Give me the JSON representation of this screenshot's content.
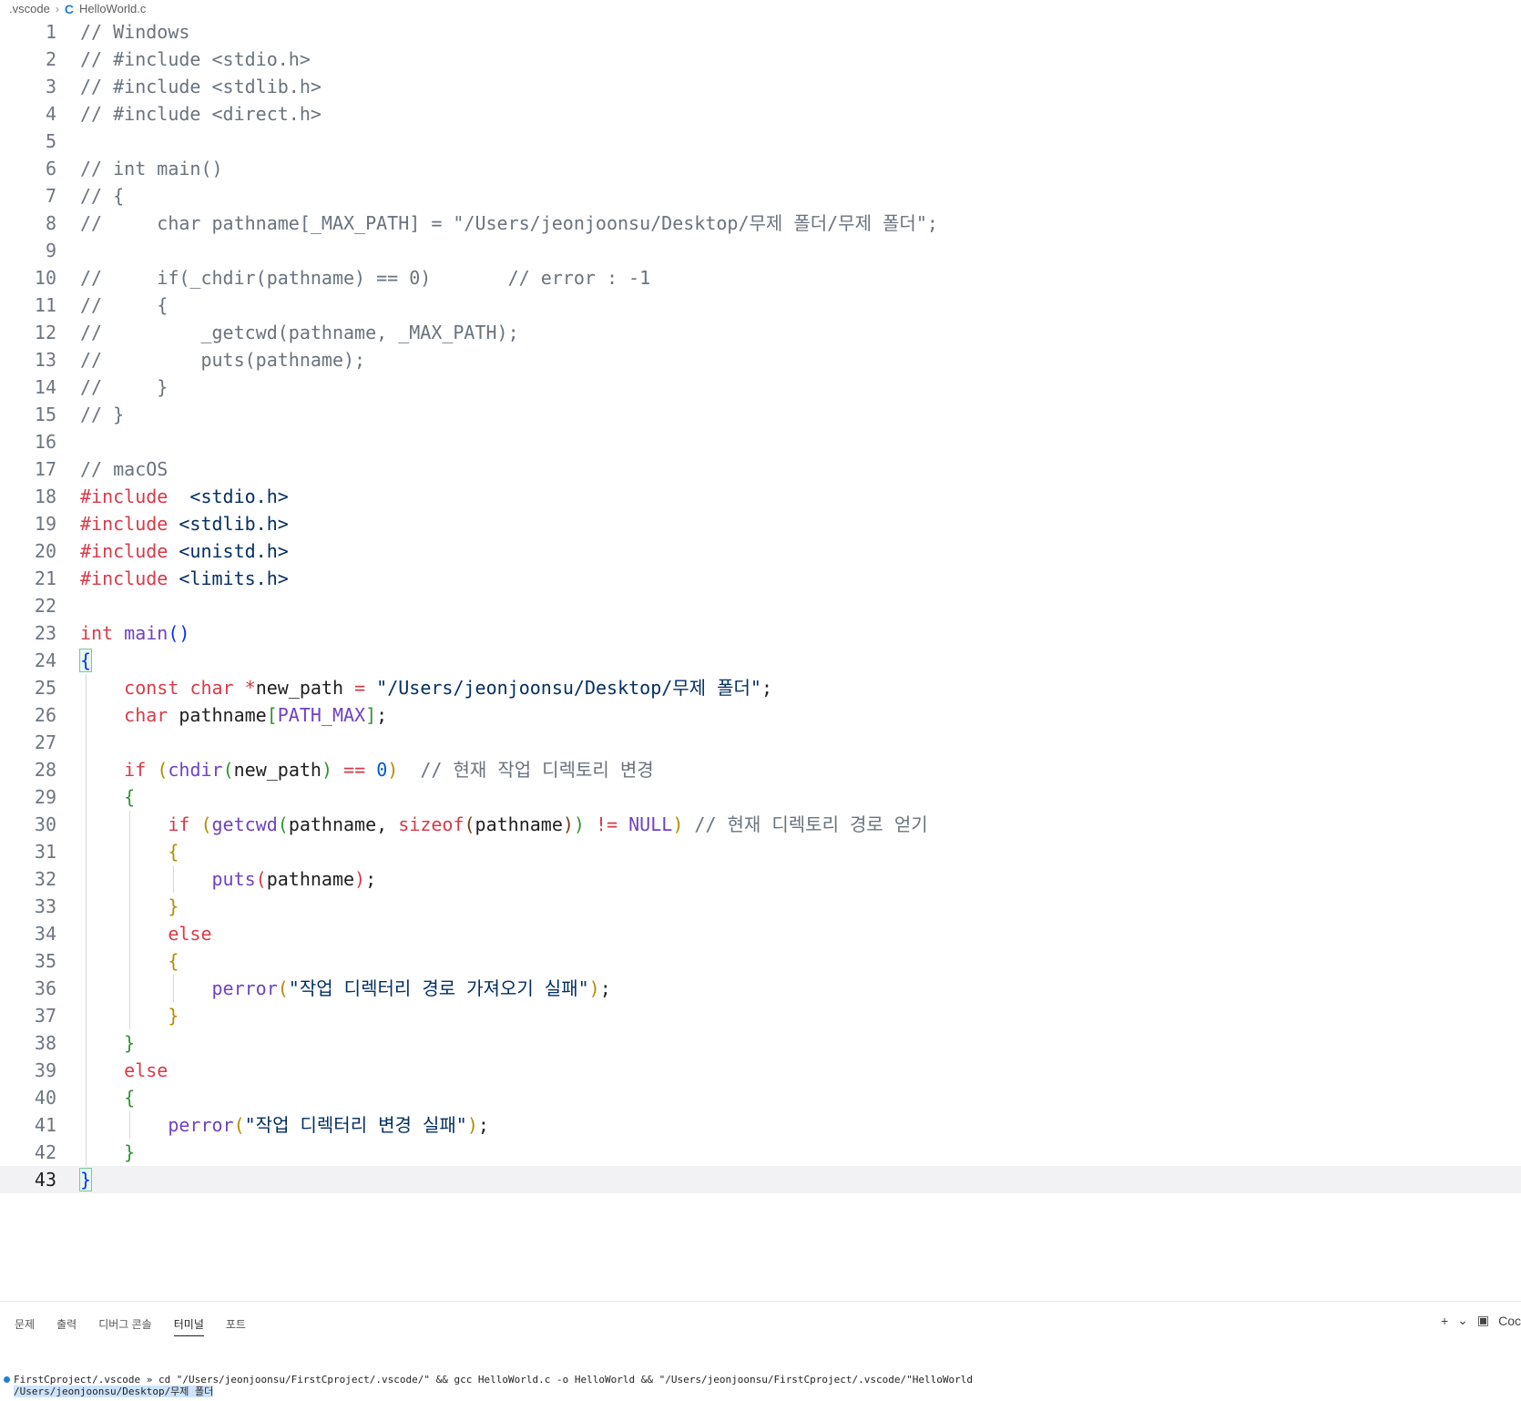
{
  "breadcrumb": {
    "folder": ".vscode",
    "file": "HelloWorld.c",
    "file_icon": "c-language-icon"
  },
  "editor": {
    "current_line": 43,
    "lines": [
      [
        [
          "cm",
          "// Windows"
        ]
      ],
      [
        [
          "cm",
          "// #include <stdio.h>"
        ]
      ],
      [
        [
          "cm",
          "// #include <stdlib.h>"
        ]
      ],
      [
        [
          "cm",
          "// #include <direct.h>"
        ]
      ],
      [],
      [
        [
          "cm",
          "// int main()"
        ]
      ],
      [
        [
          "cm",
          "// {"
        ]
      ],
      [
        [
          "cm",
          "//     char pathname[_MAX_PATH] = \"/Users/jeonjoonsu/Desktop/무제 폴더/무제 폴더\";"
        ]
      ],
      [],
      [
        [
          "cm",
          "//     if(_chdir(pathname) == 0)       // error : -1"
        ]
      ],
      [
        [
          "cm",
          "//     {"
        ]
      ],
      [
        [
          "cm",
          "//         _getcwd(pathname, _MAX_PATH);"
        ]
      ],
      [
        [
          "cm",
          "//         puts(pathname);"
        ]
      ],
      [
        [
          "cm",
          "//     }"
        ]
      ],
      [
        [
          "cm",
          "// }"
        ]
      ],
      [],
      [
        [
          "cm",
          "// macOS"
        ]
      ],
      [
        [
          "pp",
          "#include"
        ],
        [
          "",
          "  "
        ],
        [
          "hdr",
          "<stdio.h>"
        ]
      ],
      [
        [
          "pp",
          "#include"
        ],
        [
          "",
          " "
        ],
        [
          "hdr",
          "<stdlib.h>"
        ]
      ],
      [
        [
          "pp",
          "#include"
        ],
        [
          "",
          " "
        ],
        [
          "hdr",
          "<unistd.h>"
        ]
      ],
      [
        [
          "pp",
          "#include"
        ],
        [
          "",
          " "
        ],
        [
          "hdr",
          "<limits.h>"
        ]
      ],
      [],
      [
        [
          "kw",
          "int"
        ],
        [
          "",
          " "
        ],
        [
          "fn",
          "main"
        ],
        [
          "br1",
          "()"
        ]
      ],
      [
        [
          "br1hl",
          "{"
        ]
      ],
      [
        [
          "",
          "    "
        ],
        [
          "kw",
          "const"
        ],
        [
          "",
          " "
        ],
        [
          "kw",
          "char"
        ],
        [
          "",
          " "
        ],
        [
          "op",
          "*"
        ],
        [
          "",
          "new_path "
        ],
        [
          "op",
          "="
        ],
        [
          "",
          " "
        ],
        [
          "str",
          "\"/Users/jeonjoonsu/Desktop/무제 폴더\""
        ],
        [
          "",
          ";"
        ]
      ],
      [
        [
          "",
          "    "
        ],
        [
          "kw",
          "char"
        ],
        [
          "",
          " pathname"
        ],
        [
          "br2",
          "["
        ],
        [
          "const",
          "PATH_MAX"
        ],
        [
          "br2",
          "]"
        ],
        [
          "",
          ";"
        ]
      ],
      [],
      [
        [
          "",
          "    "
        ],
        [
          "kw",
          "if"
        ],
        [
          "",
          " "
        ],
        [
          "br0",
          "("
        ],
        [
          "fn",
          "chdir"
        ],
        [
          "br2",
          "("
        ],
        [
          "",
          "new_path"
        ],
        [
          "br2",
          ")"
        ],
        [
          "",
          " "
        ],
        [
          "op",
          "=="
        ],
        [
          "",
          " "
        ],
        [
          "num",
          "0"
        ],
        [
          "br0",
          ")"
        ],
        [
          "",
          "  "
        ],
        [
          "cm",
          "// 현재 작업 디렉토리 변경"
        ]
      ],
      [
        [
          "",
          "    "
        ],
        [
          "br2",
          "{"
        ]
      ],
      [
        [
          "",
          "        "
        ],
        [
          "kw",
          "if"
        ],
        [
          "",
          " "
        ],
        [
          "br0",
          "("
        ],
        [
          "fn",
          "getcwd"
        ],
        [
          "br2",
          "("
        ],
        [
          "",
          "pathname, "
        ],
        [
          "kw",
          "sizeof"
        ],
        [
          "br3",
          "("
        ],
        [
          "",
          "pathname"
        ],
        [
          "br3",
          ")"
        ],
        [
          "br2",
          ")"
        ],
        [
          "",
          " "
        ],
        [
          "op",
          "!="
        ],
        [
          "",
          " "
        ],
        [
          "const",
          "NULL"
        ],
        [
          "br0",
          ")"
        ],
        [
          "",
          " "
        ],
        [
          "cm",
          "// 현재 디렉토리 경로 얻기"
        ]
      ],
      [
        [
          "",
          "        "
        ],
        [
          "br0",
          "{"
        ]
      ],
      [
        [
          "",
          "            "
        ],
        [
          "fn",
          "puts"
        ],
        [
          "red",
          "("
        ],
        [
          "",
          "pathname"
        ],
        [
          "red",
          ")"
        ],
        [
          "",
          ";"
        ]
      ],
      [
        [
          "",
          "        "
        ],
        [
          "br0",
          "}"
        ]
      ],
      [
        [
          "",
          "        "
        ],
        [
          "kw",
          "else"
        ]
      ],
      [
        [
          "",
          "        "
        ],
        [
          "br0",
          "{"
        ]
      ],
      [
        [
          "",
          "            "
        ],
        [
          "fn",
          "perror"
        ],
        [
          "br0",
          "("
        ],
        [
          "str",
          "\"작업 디렉터리 경로 가져오기 실패\""
        ],
        [
          "br0",
          ")"
        ],
        [
          "",
          ";"
        ]
      ],
      [
        [
          "",
          "        "
        ],
        [
          "br0",
          "}"
        ]
      ],
      [
        [
          "",
          "    "
        ],
        [
          "br2",
          "}"
        ]
      ],
      [
        [
          "",
          "    "
        ],
        [
          "kw",
          "else"
        ]
      ],
      [
        [
          "",
          "    "
        ],
        [
          "br2",
          "{"
        ]
      ],
      [
        [
          "",
          "        "
        ],
        [
          "fn",
          "perror"
        ],
        [
          "br0",
          "("
        ],
        [
          "str",
          "\"작업 디렉터리 변경 실패\""
        ],
        [
          "br0",
          ")"
        ],
        [
          "",
          ";"
        ]
      ],
      [
        [
          "",
          "    "
        ],
        [
          "br2",
          "}"
        ]
      ],
      [
        [
          "br1hl",
          "}"
        ]
      ]
    ]
  },
  "panel": {
    "tabs": [
      "문제",
      "출력",
      "디버그 콘솔",
      "터미널",
      "포트"
    ],
    "active_tab": "터미널",
    "new_terminal_label": "+",
    "terminal_profile_label": "Coc",
    "terminal_lines": [
      "FirstCproject/.vscode » cd \"/Users/jeonjoonsu/FirstCproject/.vscode/\" && gcc HelloWorld.c -o HelloWorld && \"/Users/jeonjoonsu/FirstCproject/.vscode/\"HelloWorld",
      "/Users/jeonjoonsu/Desktop/무제 폴더"
    ]
  }
}
